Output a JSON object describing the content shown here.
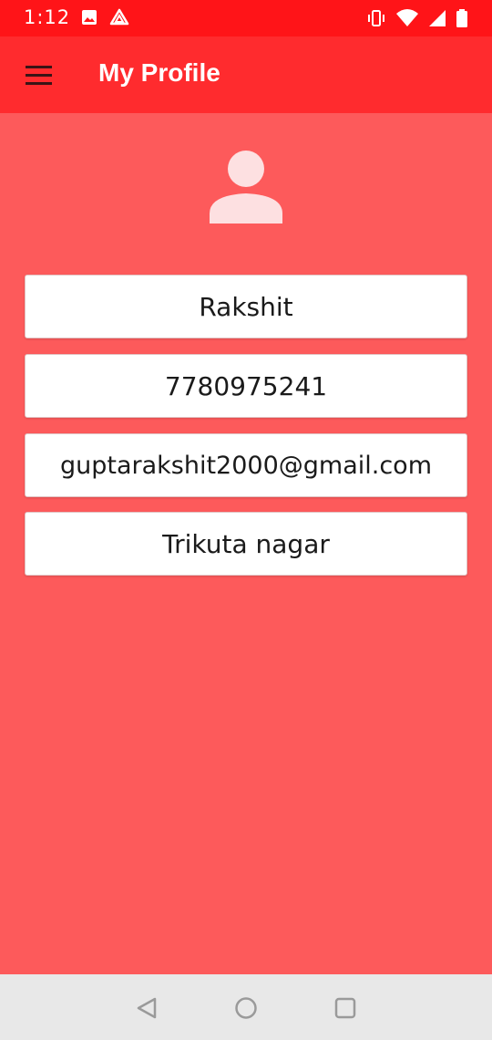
{
  "status_bar": {
    "time": "1:12",
    "icons_left": [
      "image-icon",
      "drive-icon"
    ],
    "icons_right": [
      "vibrate-icon",
      "wifi-icon",
      "signal-icon",
      "battery-icon"
    ]
  },
  "app_bar": {
    "title": "My Profile",
    "menu_icon": "hamburger-menu-icon",
    "color": "#ff2b2e"
  },
  "profile": {
    "avatar_icon": "person-icon",
    "name": "Rakshit",
    "phone": "7780975241",
    "email": "guptarakshit2000@gmail.com",
    "address": "Trikuta nagar"
  },
  "nav_bar": {
    "buttons": [
      "back-icon",
      "home-icon",
      "recents-icon"
    ]
  },
  "colors": {
    "background": "#fd5a5b",
    "status_bar": "#ff1418"
  }
}
